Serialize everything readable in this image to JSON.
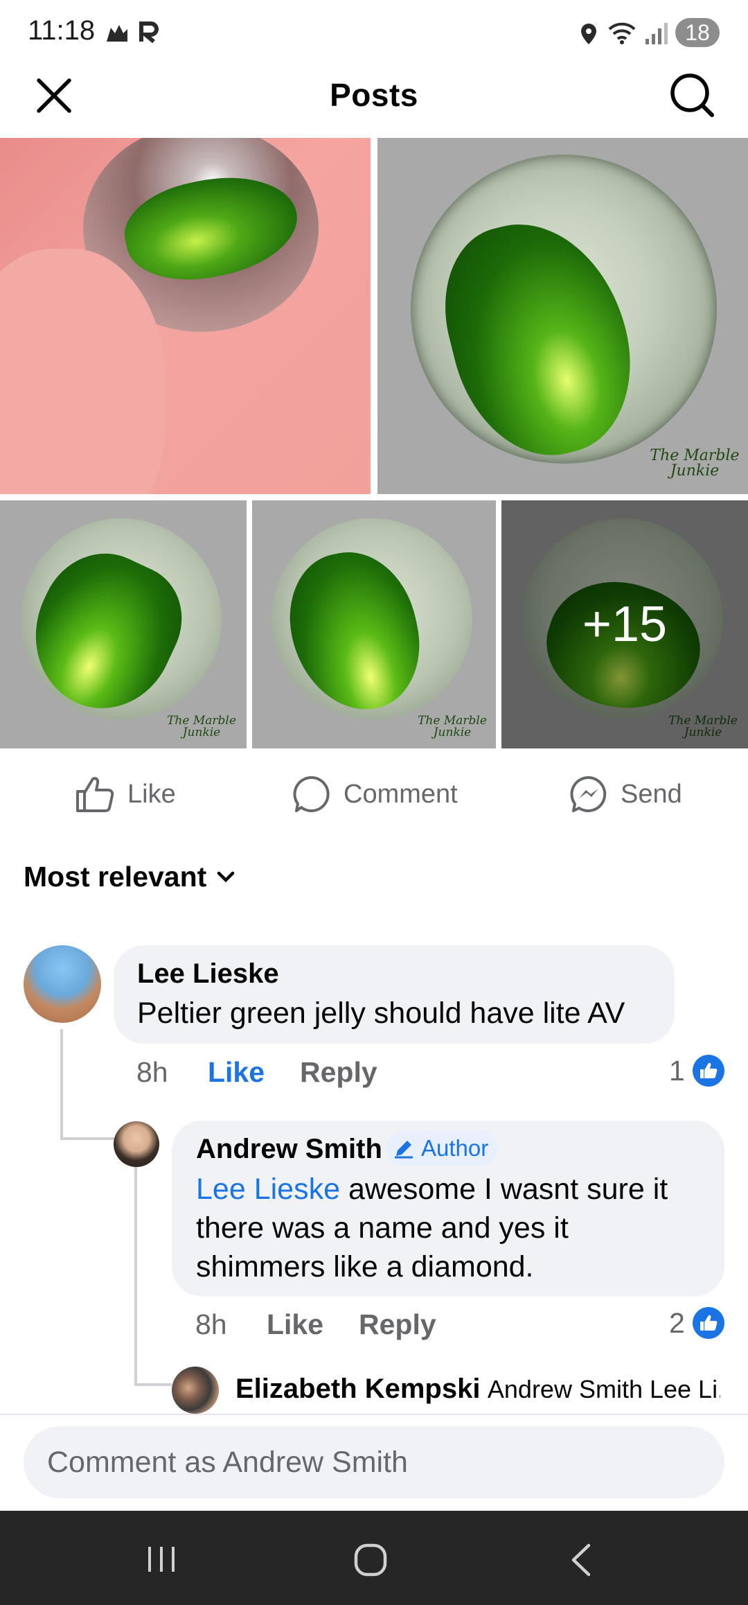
{
  "status_bar": {
    "time": "11:18",
    "battery": "18"
  },
  "header": {
    "title": "Posts"
  },
  "media": {
    "more_count": "+15",
    "watermark_line1": "The Marble",
    "watermark_line2": "Junkie"
  },
  "actions": {
    "like": "Like",
    "comment": "Comment",
    "send": "Send"
  },
  "sort": {
    "label": "Most relevant"
  },
  "comments": [
    {
      "author": "Lee Lieske",
      "text": "Peltier green jelly should have lite AV",
      "time": "8h",
      "like": "Like",
      "reply": "Reply",
      "likes": "1"
    },
    {
      "author": "Andrew Smith",
      "badge": "Author",
      "mention": "Lee Lieske",
      "text_line1": "awesome I wasnt sure it",
      "text_line2": "there was a name and yes it",
      "text_line3": "shimmers like a diamond.",
      "time": "8h",
      "like": "Like",
      "reply": "Reply",
      "likes": "2"
    },
    {
      "author": "Elizabeth Kempski",
      "preview": "Andrew Smith Lee Li..."
    }
  ],
  "composer": {
    "placeholder": "Comment as Andrew Smith"
  },
  "colors": {
    "accent": "#1b74e4",
    "bubble": "#f0f2f5",
    "marble_green": "#2f8a14"
  }
}
